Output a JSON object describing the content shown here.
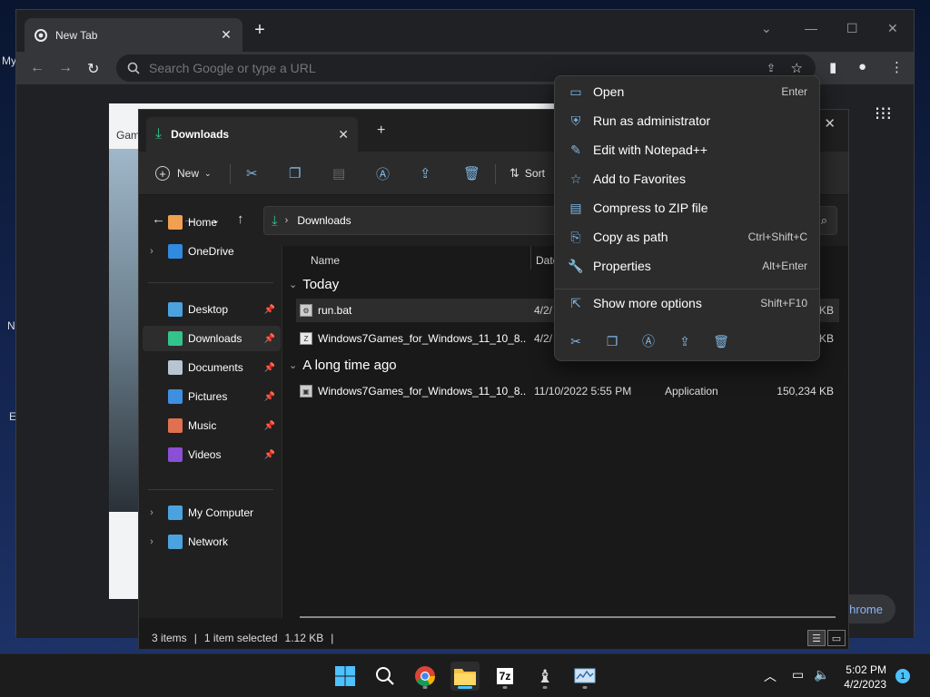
{
  "desktop": {
    "frag_my": "My",
    "frag_n": "N",
    "frag_e": "E"
  },
  "chrome": {
    "tab_title": "New Tab",
    "omnibox_placeholder": "Search Google or type a URL",
    "ntp_frag": "Gam",
    "customize_label": "hrome"
  },
  "explorer": {
    "tab_title": "Downloads",
    "cmd": {
      "new_label": "New",
      "sort_label": "Sort"
    },
    "address": "Downloads",
    "nav": [
      {
        "label": "Home",
        "icon": "home-icon",
        "color": "#f0a050",
        "pinned": false,
        "chev": false
      },
      {
        "label": "OneDrive",
        "icon": "cloud-icon",
        "color": "#2f8ae0",
        "pinned": false,
        "chev": true
      },
      {
        "label": "Desktop",
        "icon": "desktop-icon",
        "color": "#4aa3df",
        "pinned": true,
        "chev": false
      },
      {
        "label": "Downloads",
        "icon": "download-icon",
        "color": "#33c48c",
        "pinned": true,
        "chev": false
      },
      {
        "label": "Documents",
        "icon": "document-icon",
        "color": "#b8c4d0",
        "pinned": true,
        "chev": false
      },
      {
        "label": "Pictures",
        "icon": "pictures-icon",
        "color": "#3f8fe0",
        "pinned": true,
        "chev": false
      },
      {
        "label": "Music",
        "icon": "music-icon",
        "color": "#e0704f",
        "pinned": true,
        "chev": false
      },
      {
        "label": "Videos",
        "icon": "videos-icon",
        "color": "#8b4fd6",
        "pinned": true,
        "chev": false
      },
      {
        "label": "My Computer",
        "icon": "computer-icon",
        "color": "#4aa3df",
        "pinned": false,
        "chev": true
      },
      {
        "label": "Network",
        "icon": "network-icon",
        "color": "#4aa3df",
        "pinned": false,
        "chev": true
      }
    ],
    "columns": {
      "name": "Name",
      "date": "Date"
    },
    "groups": {
      "today": "Today",
      "long_ago": "A long time ago"
    },
    "files": [
      {
        "name": "run.bat",
        "date": "4/2/",
        "type": "",
        "size": "KB"
      },
      {
        "name": "Windows7Games_for_Windows_11_10_8....",
        "date": "4/2/",
        "type": "",
        "size": "KB"
      },
      {
        "name": "Windows7Games_for_Windows_11_10_8....",
        "date": "11/10/2022 5:55 PM",
        "type": "Application",
        "size": "150,234 KB"
      }
    ],
    "status": {
      "items": "3 items",
      "selected": "1 item selected",
      "size": "1.12 KB"
    }
  },
  "context_menu": {
    "items": [
      {
        "label": "Open",
        "shortcut": "Enter",
        "icon": "open-icon"
      },
      {
        "label": "Run as administrator",
        "shortcut": "",
        "icon": "shield-icon"
      },
      {
        "label": "Edit with Notepad++",
        "shortcut": "",
        "icon": "pin-icon"
      },
      {
        "label": "Add to Favorites",
        "shortcut": "",
        "icon": "star-icon"
      },
      {
        "label": "Compress to ZIP file",
        "shortcut": "",
        "icon": "zip-icon"
      },
      {
        "label": "Copy as path",
        "shortcut": "Ctrl+Shift+C",
        "icon": "copy-path-icon"
      },
      {
        "label": "Properties",
        "shortcut": "Alt+Enter",
        "icon": "wrench-icon"
      },
      {
        "label": "Show more options",
        "shortcut": "Shift+F10",
        "icon": "more-options-icon"
      }
    ]
  },
  "taskbar": {
    "sevenzip_label": "7z",
    "time": "5:02 PM",
    "date": "4/2/2023",
    "notif_count": "1"
  },
  "colors": {
    "accent": "#4cc2ff",
    "icon_blue": "#7fb8e6",
    "download_green": "#33c48c"
  }
}
